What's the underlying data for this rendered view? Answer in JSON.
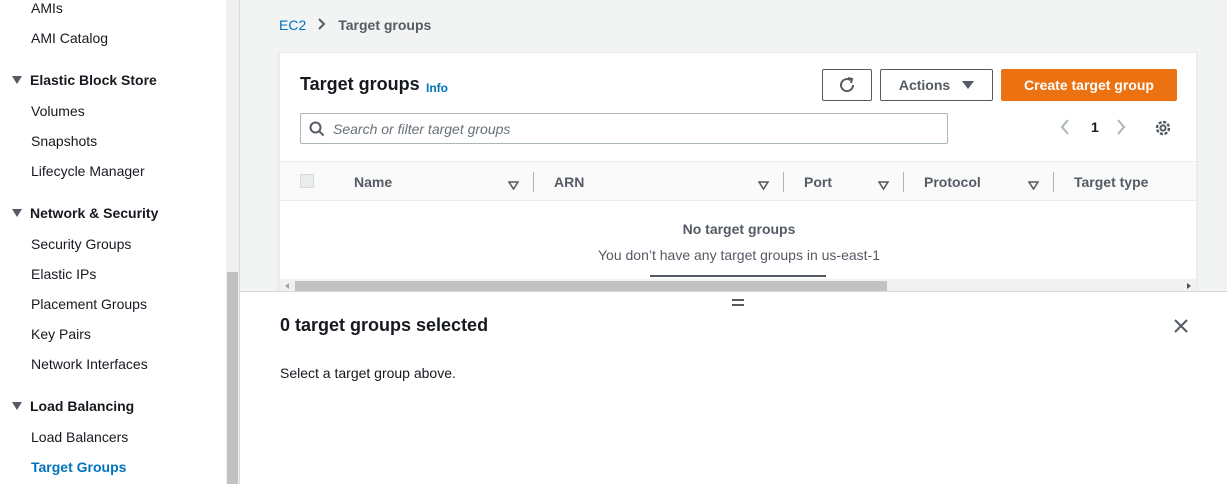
{
  "sidebar": {
    "items_top": [
      "AMIs",
      "AMI Catalog"
    ],
    "sections": [
      {
        "title": "Elastic Block Store",
        "items": [
          "Volumes",
          "Snapshots",
          "Lifecycle Manager"
        ]
      },
      {
        "title": "Network & Security",
        "items": [
          "Security Groups",
          "Elastic IPs",
          "Placement Groups",
          "Key Pairs",
          "Network Interfaces"
        ]
      },
      {
        "title": "Load Balancing",
        "items": [
          "Load Balancers",
          "Target Groups"
        ]
      }
    ],
    "active_item": "Target Groups"
  },
  "breadcrumb": {
    "root": "EC2",
    "current": "Target groups"
  },
  "panel": {
    "title": "Target groups",
    "info": "Info",
    "actions_label": "Actions",
    "create_label": "Create target group",
    "search_placeholder": "Search or filter target groups",
    "page": "1",
    "columns": [
      "Name",
      "ARN",
      "Port",
      "Protocol",
      "Target type"
    ],
    "empty_title": "No target groups",
    "empty_sub": "You don’t have any target groups in us-east-1"
  },
  "split": {
    "title": "0 target groups selected",
    "message": "Select a target group above."
  },
  "colors": {
    "primary": "#ec7211",
    "link": "#0073bb"
  },
  "icons": [
    "refresh-icon",
    "caret-down-icon",
    "search-icon",
    "chevron-left-icon",
    "chevron-right-icon",
    "gear-icon",
    "sort-icon",
    "close-icon",
    "drag-handle-icon"
  ]
}
